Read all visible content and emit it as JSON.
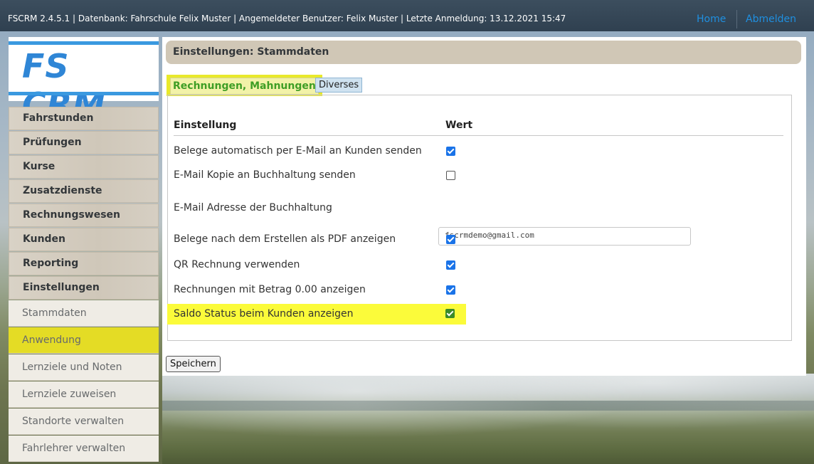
{
  "topbar": {
    "info": "FSCRM 2.4.5.1 | Datenbank: Fahrschule Felix Muster | Angemeldeter Benutzer: Felix Muster | Letzte Anmeldung: 13.12.2021 15:47",
    "home_label": "Home",
    "logout_label": "Abmelden"
  },
  "logo": {
    "text": "FS CRM"
  },
  "menu": [
    {
      "label": "Fahrstunden"
    },
    {
      "label": "Prüfungen"
    },
    {
      "label": "Kurse"
    },
    {
      "label": "Zusatzdienste"
    },
    {
      "label": "Rechnungswesen"
    },
    {
      "label": "Kunden"
    },
    {
      "label": "Reporting"
    },
    {
      "label": "Einstellungen"
    }
  ],
  "submenu": [
    {
      "label": "Stammdaten"
    },
    {
      "label": "Anwendung",
      "highlighted": true
    },
    {
      "label": "Lernziele und Noten"
    },
    {
      "label": "Lernziele zuweisen"
    },
    {
      "label": "Standorte verwalten"
    },
    {
      "label": "Fahrlehrer verwalten"
    }
  ],
  "page": {
    "title": "Einstellungen: Stammdaten",
    "tabs": [
      {
        "label": "Rechnungen, Mahnungen",
        "active": true
      },
      {
        "label": "Diverses",
        "active": false
      }
    ],
    "table": {
      "col_setting": "Einstellung",
      "col_value": "Wert"
    },
    "settings": [
      {
        "label": "Belege automatisch per E-Mail an Kunden senden",
        "checked": true
      },
      {
        "label": "E-Mail Kopie an Buchhaltung senden",
        "checked": false
      },
      {
        "label": "E-Mail Adresse der Buchhaltung",
        "value": "fscrmdemo@gmail.com"
      },
      {
        "label": "Belege nach dem Erstellen als PDF anzeigen",
        "checked": true
      },
      {
        "label": "QR Rechnung verwenden",
        "checked": true
      },
      {
        "label": "Rechnungen mit Betrag 0.00 anzeigen",
        "checked": true
      },
      {
        "label": "Saldo Status beim Kunden anzeigen",
        "checked": true,
        "highlighted": true
      }
    ],
    "save_label": "Speichern"
  },
  "colors": {
    "topbar": "#34475a",
    "accent_blue": "#1f8fe0",
    "highlight_yellow": "#fbfb3a",
    "tab_active_text": "#3f9e25",
    "checkbox_checked": "#1a73e8"
  }
}
